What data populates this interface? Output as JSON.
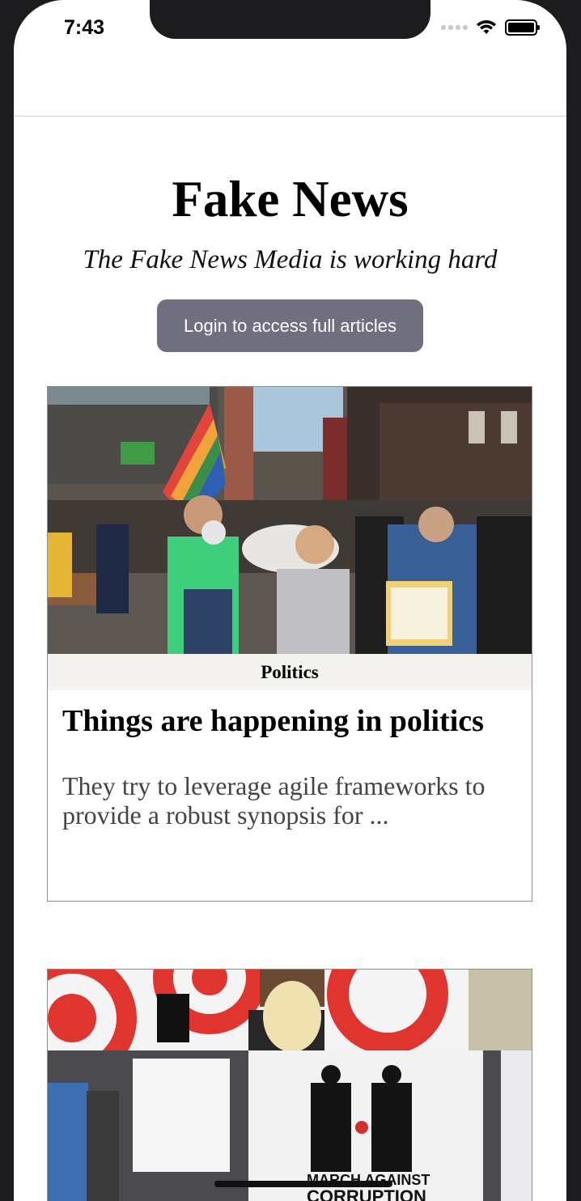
{
  "status_bar": {
    "time": "7:43"
  },
  "masthead": {
    "title": "Fake News",
    "tagline": "The Fake News Media is working hard",
    "login_label": "Login to access full articles"
  },
  "articles": [
    {
      "category": "Politics",
      "headline": "Things are happening in politics",
      "excerpt": "They try to leverage agile frameworks to provide a robust synopsis for ..."
    },
    {
      "sign_text_top": "MARCH AGAINST",
      "sign_text_bottom": "CORRUPTION"
    }
  ],
  "colors": {
    "button": "#6f6f80",
    "category_bar": "#f5f3ef",
    "excerpt_text": "#444444",
    "frame": "#1c1c1e"
  }
}
